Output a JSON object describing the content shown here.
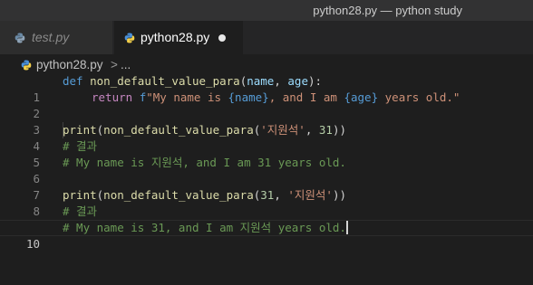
{
  "window": {
    "title": "python28.py — python study"
  },
  "tabs": [
    {
      "label": "test.py",
      "active": false
    },
    {
      "label": "python28.py",
      "active": true,
      "dirty": true
    }
  ],
  "breadcrumb": {
    "file": "python28.py",
    "separator": ">",
    "more": "..."
  },
  "colors": {
    "keyword": "#569cd6",
    "control": "#c586c0",
    "function": "#dcdcaa",
    "param": "#9cdcfe",
    "string": "#ce9178",
    "comment": "#6a9955",
    "number": "#b5cea8"
  },
  "editor": {
    "current_line": 10,
    "lines": [
      {
        "n": "1",
        "tokens": {
          "def": "def",
          "fn": "non_default_value_para",
          "open": "(",
          "p1": "name",
          "comma": ", ",
          "p2": "age",
          "close": "):"
        }
      },
      {
        "n": "2",
        "tokens": {
          "ret": "return",
          "sp": " ",
          "fpre": "f",
          "s1": "\"My name is ",
          "b1": "{name}",
          "s2": ", and I am ",
          "b2": "{age}",
          "s3": " years old.\""
        }
      },
      {
        "n": "3"
      },
      {
        "n": "4",
        "tokens": {
          "print": "print",
          "o1": "(",
          "fn": "non_default_value_para",
          "o2": "(",
          "str": "'지원석'",
          "comma": ", ",
          "num": "31",
          "close": "))"
        }
      },
      {
        "n": "5",
        "text": "# 결과"
      },
      {
        "n": "6",
        "text": "# My name is 지원석, and I am 31 years old."
      },
      {
        "n": "7"
      },
      {
        "n": "8",
        "tokens": {
          "print": "print",
          "o1": "(",
          "fn": "non_default_value_para",
          "o2": "(",
          "num": "31",
          "comma": ", ",
          "str": "'지원석'",
          "close": "))"
        }
      },
      {
        "n": "9",
        "text": "# 결과"
      },
      {
        "n": "10",
        "text": "# My name is 31, and I am 지원석 years old."
      }
    ]
  }
}
